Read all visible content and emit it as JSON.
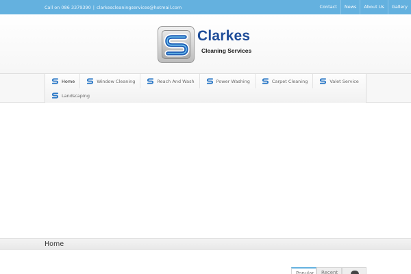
{
  "topbar": {
    "phone_text": "Call on 086 3379390",
    "separator": "|",
    "email": "clarkescleaningservices@hotmail.com",
    "nav": [
      "Contact",
      "News",
      "About Us",
      "Gallery"
    ]
  },
  "logo": {
    "name": "Clarkes",
    "tagline": "Cleaning Services"
  },
  "menu": {
    "items": [
      "Home",
      "Window Cleaning",
      "Reach And Wash",
      "Power Washing",
      "Carpet Cleaning",
      "Valet Service",
      "Landscaping"
    ]
  },
  "breadcrumb": {
    "current": "Home"
  },
  "sidebar_tabs": [
    "Popular",
    "Recent"
  ],
  "colors": {
    "brand_blue": "#64b1df",
    "logo_blue": "#1f4d99"
  }
}
